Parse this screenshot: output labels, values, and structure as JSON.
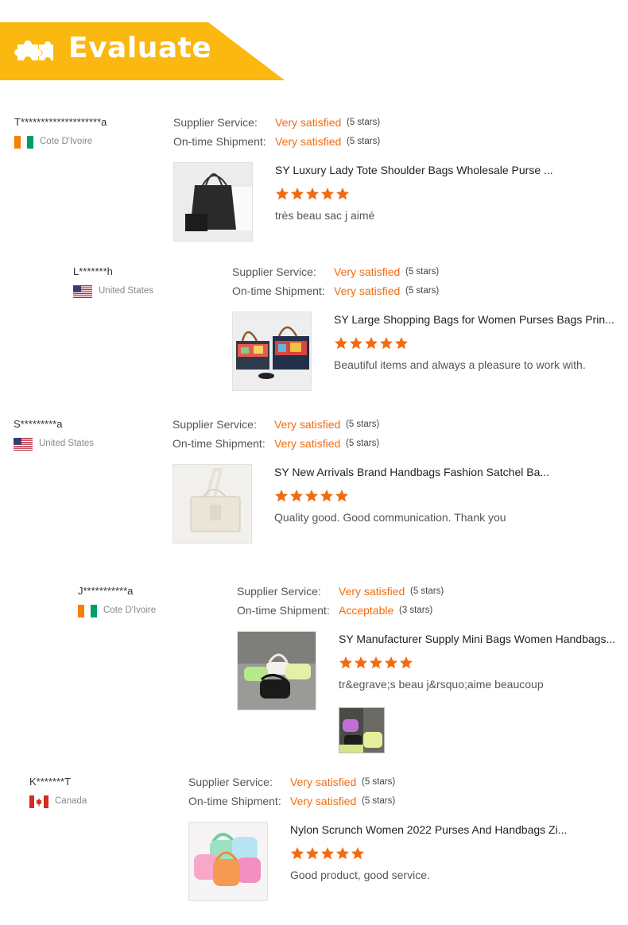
{
  "header": {
    "title": "Evaluate",
    "banner_color": "#fbb810",
    "icon": "puzzle-icon"
  },
  "colors": {
    "accent": "#f26b10",
    "star": "#f26b10"
  },
  "labels": {
    "supplier_service": "Supplier Service:",
    "ontime_shipment": "On-time Shipment:"
  },
  "reviews": [
    {
      "buyer": "T********************a",
      "country": "Cote D'Ivoire",
      "flag": "cote-divoire-flag",
      "supplier_service": "Very satisfied",
      "supplier_service_stars": "(5 stars)",
      "shipment": "Very satisfied",
      "shipment_stars": "(5 stars)",
      "product_title": "SY Luxury Lady Tote Shoulder Bags Wholesale Purse ...",
      "rating": 5,
      "comment": "très beau sac j aimé"
    },
    {
      "buyer": "L*******h",
      "country": "United States",
      "flag": "usa-flag",
      "supplier_service": "Very satisfied",
      "supplier_service_stars": "(5 stars)",
      "shipment": "Very satisfied",
      "shipment_stars": "(5 stars)",
      "product_title": "SY Large Shopping Bags for Women Purses Bags Prin...",
      "rating": 5,
      "comment": "Beautiful items and always a pleasure to work with."
    },
    {
      "buyer": "S*********a",
      "country": "United States",
      "flag": "usa-flag",
      "supplier_service": "Very satisfied",
      "supplier_service_stars": "(5 stars)",
      "shipment": "Very satisfied",
      "shipment_stars": "(5 stars)",
      "product_title": "SY New Arrivals Brand Handbags Fashion Satchel Ba...",
      "rating": 5,
      "comment": "Quality good. Good communication. Thank you"
    },
    {
      "buyer": "J***********a",
      "country": "Cote D'Ivoire",
      "flag": "cote-divoire-flag",
      "supplier_service": "Very satisfied",
      "supplier_service_stars": "(5 stars)",
      "shipment": "Acceptable",
      "shipment_stars": "(3 stars)",
      "product_title": "SY Manufacturer Supply Mini Bags Women Handbags...",
      "rating": 5,
      "comment": "tr&egrave;s beau j&rsquo;aime beaucoup"
    },
    {
      "buyer": "K*******T",
      "country": "Canada",
      "flag": "canada-flag",
      "supplier_service": "Very satisfied",
      "supplier_service_stars": "(5 stars)",
      "shipment": "Very satisfied",
      "shipment_stars": "(5 stars)",
      "product_title": "Nylon Scrunch Women 2022 Purses And Handbags Zi...",
      "rating": 5,
      "comment": "Good product, good service."
    }
  ]
}
